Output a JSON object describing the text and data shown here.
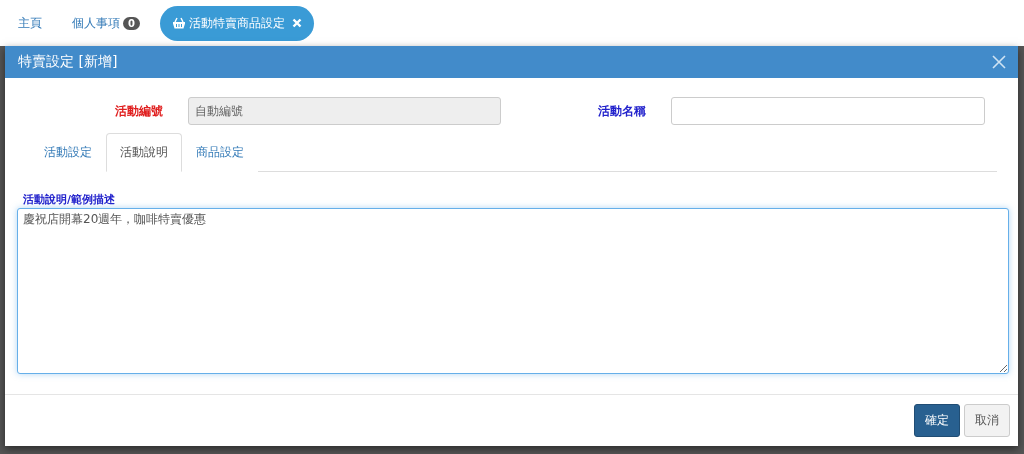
{
  "nav_tabs": [
    {
      "label": "主頁",
      "selected": false
    },
    {
      "label": "個人事項",
      "badge": "0",
      "selected": false
    },
    {
      "label": "活動特賣商品設定",
      "selected": true,
      "closable": true
    }
  ],
  "dialog": {
    "title": "特賣設定 [新增]",
    "fields": [
      {
        "label": "活動編號",
        "required": true,
        "value": "自動編號",
        "disabled": true
      },
      {
        "label": "活動名稱",
        "required": false,
        "disabled": false
      }
    ],
    "tabs": [
      {
        "label": "活動設定",
        "selected": false
      },
      {
        "label": "活動說明",
        "selected": true
      },
      {
        "label": "商品設定",
        "selected": false
      }
    ],
    "description": {
      "label": "活動說明/範例描述",
      "value": "慶祝店開幕20週年，咖啡特賣優惠"
    },
    "buttons": [
      {
        "label": "確定",
        "kind": "primary"
      },
      {
        "label": "取消",
        "kind": "default"
      }
    ]
  }
}
